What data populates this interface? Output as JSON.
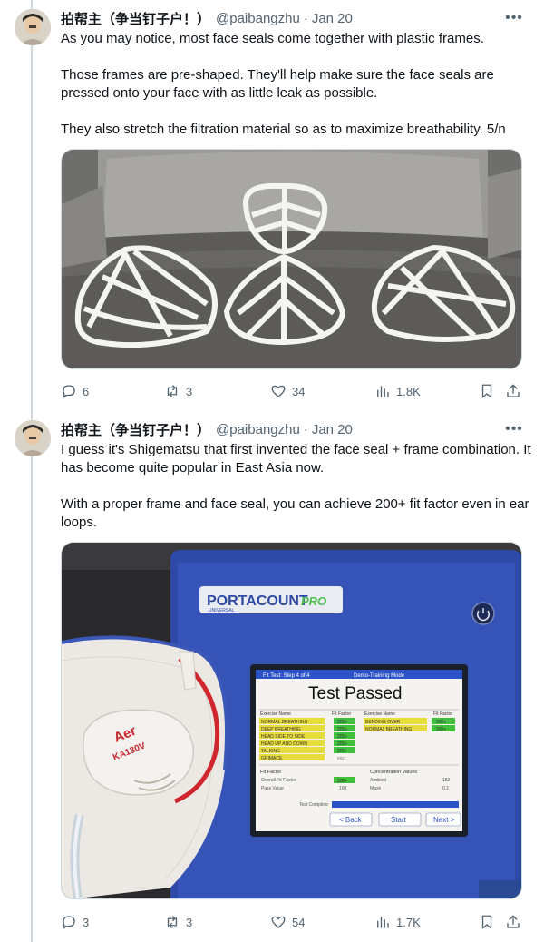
{
  "tweets": [
    {
      "author": {
        "name": "拍帮主（争当钉子户！）",
        "handle": "@paibangzhu",
        "date": "Jan 20"
      },
      "paragraphs": [
        "As you may notice, most face seals come together with plastic frames.",
        "Those frames are pre-shaped. They'll help make sure the face seals are pressed onto your face with as little leak as possible.",
        "They also stretch the filtration material so as to maximize breathability. 5/n"
      ],
      "stats": {
        "replies": "6",
        "reposts": "3",
        "likes": "34",
        "views": "1.8K"
      }
    },
    {
      "author": {
        "name": "拍帮主（争当钉子户！）",
        "handle": "@paibangzhu",
        "date": "Jan 20"
      },
      "paragraphs": [
        "I guess it's Shigematsu that first invented the face seal + frame combination. It has become quite popular in East Asia now.",
        "With a proper frame and face seal, you can achieve 200+ fit factor even in ear loops."
      ],
      "stats": {
        "replies": "3",
        "reposts": "3",
        "likes": "54",
        "views": "1.7K"
      },
      "device": {
        "brand": "PORTACOUNT",
        "brand_suffix": "PRO",
        "brand_sub": "UNIVERSAL",
        "title_bar": "Fit Test: Step 4 of 4",
        "mode": "Demo-Training Mode",
        "heading": "Test Passed",
        "col_exercise": "Exercise Name",
        "col_factor": "Fit Factor",
        "left_rows": [
          {
            "name": "NORMAL BREATHING",
            "value": "200+"
          },
          {
            "name": "DEEP BREATHING",
            "value": "200+"
          },
          {
            "name": "HEAD SIDE TO SIDE",
            "value": "200+"
          },
          {
            "name": "HEAD UP AND DOWN",
            "value": "200+"
          },
          {
            "name": "TALKING",
            "value": "200+"
          },
          {
            "name": "GRIMACE",
            "value": "excl"
          }
        ],
        "right_rows": [
          {
            "name": "BENDING OVER",
            "value": "200+"
          },
          {
            "name": "NORMAL BREATHING",
            "value": "200+"
          }
        ],
        "fit_factor_label": "Fit Factor",
        "overall_label": "Overall Fit Factor",
        "overall_value": "200+",
        "pass_label": "Pass Value",
        "pass_value": "100",
        "conc_label": "Concentration Values",
        "ambient_label": "Ambient",
        "ambient_value": "182",
        "mask_label": "Mask",
        "mask_value": "0.2",
        "complete_label": "Test Complete",
        "back_label": "< Back",
        "start_label": "Start",
        "next_label": "Next >",
        "mask_brand": "Aer",
        "mask_model": "KA130V"
      }
    }
  ]
}
